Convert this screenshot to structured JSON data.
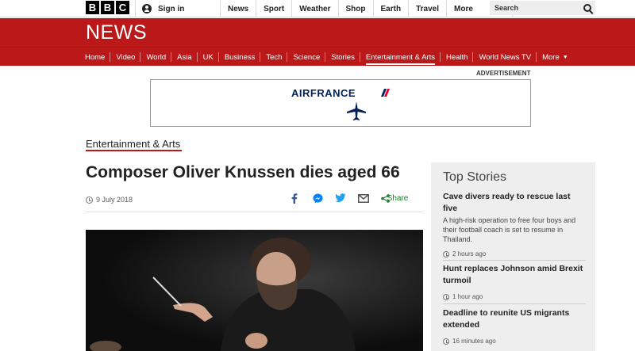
{
  "topbar": {
    "logo_letters": [
      "B",
      "B",
      "C"
    ],
    "signin_label": "Sign in",
    "links": [
      "News",
      "Sport",
      "Weather",
      "Shop",
      "Earth",
      "Travel"
    ],
    "more_label": "More",
    "search_placeholder": "Search"
  },
  "header": {
    "title": "NEWS",
    "brand_color": "#bb1919"
  },
  "nav": {
    "items": [
      "Home",
      "Video",
      "World",
      "Asia",
      "UK",
      "Business",
      "Tech",
      "Science",
      "Stories",
      "Entertainment & Arts",
      "Health",
      "World News TV"
    ],
    "active": "Entertainment & Arts",
    "more_label": "More"
  },
  "advert": {
    "label": "ADVERTISEMENT",
    "brand": "AIRFRANCE"
  },
  "article": {
    "section": "Entertainment & Arts",
    "headline": "Composer Oliver Knussen dies aged 66",
    "date": "9 July 2018",
    "share_label": "Share",
    "share_icons": [
      "facebook-icon",
      "messenger-icon",
      "twitter-icon",
      "email-icon",
      "share-icon"
    ]
  },
  "top_stories": {
    "title": "Top Stories",
    "items": [
      {
        "title": "Cave divers ready to rescue last five",
        "summary": "A high-risk operation to free four boys and their football coach is set to resume in Thailand.",
        "time": "2 hours ago"
      },
      {
        "title": "Hunt replaces Johnson amid Brexit turmoil",
        "summary": "",
        "time": "1 hour ago"
      },
      {
        "title": "Deadline to reunite US migrants extended",
        "summary": "",
        "time": "16 minutes ago"
      }
    ]
  }
}
